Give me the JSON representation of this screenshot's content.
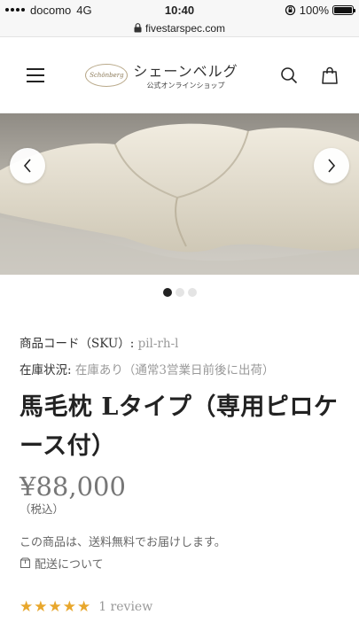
{
  "status_bar": {
    "carrier": "docomo",
    "network": "4G",
    "time": "10:40",
    "battery": "100%"
  },
  "url_bar": {
    "domain": "fivestarspec.com"
  },
  "header": {
    "logo_main": "シェーンベルグ",
    "logo_sub": "公式オンラインショップ",
    "logo_mark": "Schönberg"
  },
  "carousel": {
    "slide_count": 3,
    "active_index": 0
  },
  "product": {
    "sku_label": "商品コード（SKU）:",
    "sku_value": "pil-rh-l",
    "stock_label": "在庫状況:",
    "stock_value": "在庫あり（通常3営業日前後に出荷）",
    "title": "馬毛枕 Lタイプ（専用ピロケース付）",
    "price": "¥88,000",
    "tax_note": "（税込）",
    "shipping_note": "この商品は、送料無料でお届けします。",
    "shipping_link": "配送について",
    "stars": "★★★★★",
    "review_text": "1 review",
    "star_color": "#e8a72c"
  }
}
